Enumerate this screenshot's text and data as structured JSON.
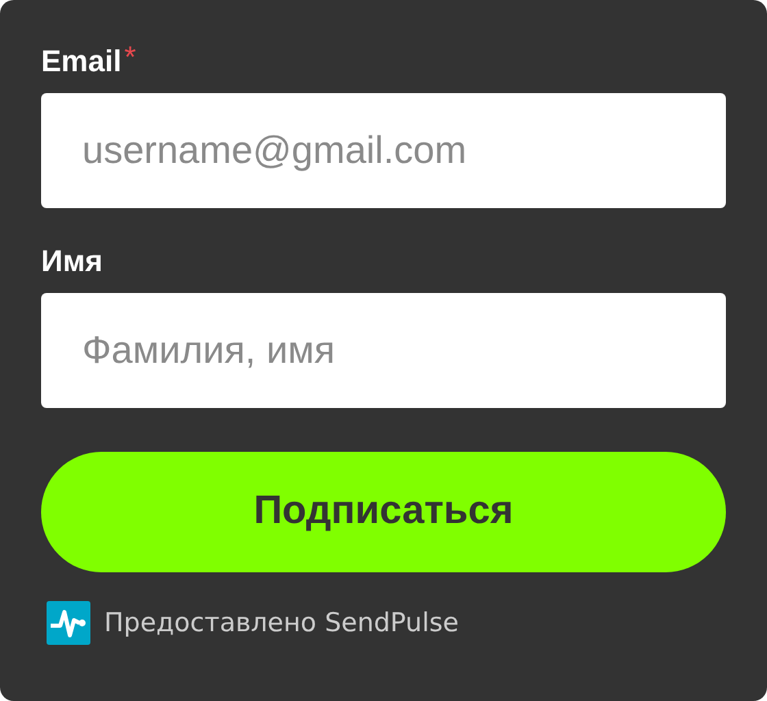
{
  "fields": [
    {
      "label": "Email",
      "required_mark": "*",
      "placeholder": "username@gmail.com"
    },
    {
      "label": "Имя",
      "placeholder": "Фамилия, имя"
    }
  ],
  "submit_button": {
    "label": "Подписаться"
  },
  "footer": {
    "text": "Предоставлено SendPulse"
  }
}
